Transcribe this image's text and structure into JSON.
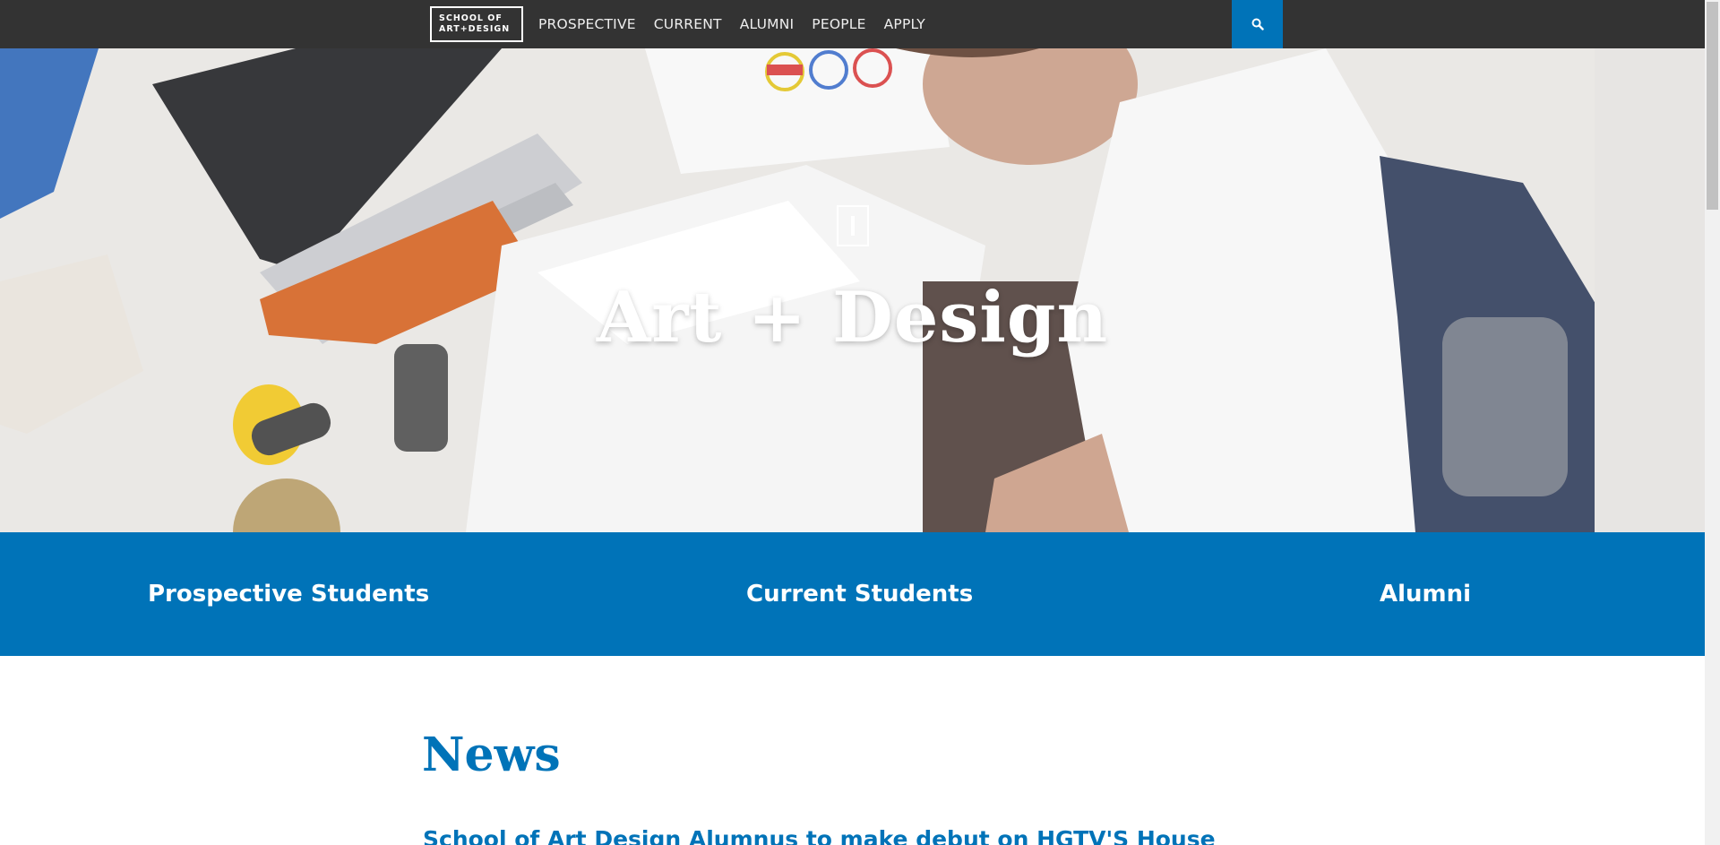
{
  "logo": {
    "line1": "SCHOOL OF",
    "line2": "ART+DESIGN"
  },
  "nav": {
    "items": [
      {
        "label": "PROSPECTIVE"
      },
      {
        "label": "CURRENT"
      },
      {
        "label": "ALUMNI"
      },
      {
        "label": "PEOPLE"
      },
      {
        "label": "APPLY"
      }
    ],
    "search_icon": "search-icon"
  },
  "hero": {
    "title": "Art + Design"
  },
  "audience_links": {
    "prospective": "Prospective Students",
    "current": "Current Students",
    "alumni": "Alumni"
  },
  "news": {
    "heading": "News",
    "first_item": "School of Art Design Alumnus to make debut on HGTV'S House"
  },
  "colors": {
    "nav_bg": "#333333",
    "accent": "#0073b8"
  }
}
